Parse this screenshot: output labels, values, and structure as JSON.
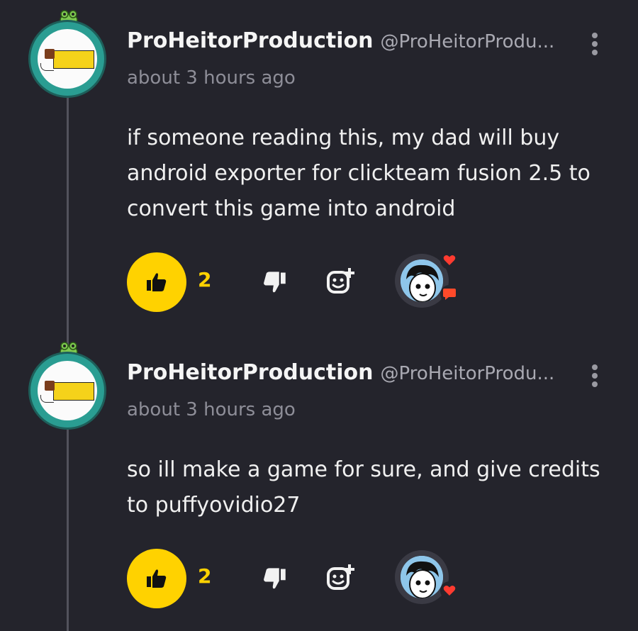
{
  "comments": [
    {
      "username": "ProHeitorProduction",
      "handle": "@ProHeitorProdu...",
      "timestamp": "about 3 hours ago",
      "text": "if someone reading this, my dad will buy android exporter for clickteam fusion 2.5 to convert this game into android",
      "likes": "2",
      "reactions": [
        "heart-icon",
        "comment-icon"
      ]
    },
    {
      "username": "ProHeitorProduction",
      "handle": "@ProHeitorProdu...",
      "timestamp": "about 3 hours ago",
      "text": "so ill make a game for sure, and give credits to puffyovidio27",
      "likes": "2",
      "reactions": [
        "heart-icon"
      ]
    }
  ],
  "colors": {
    "background": "#24242c",
    "accent_yellow": "#ffd200",
    "heart_red": "#ff3b30",
    "avatar_ring": "#2a9d92"
  }
}
